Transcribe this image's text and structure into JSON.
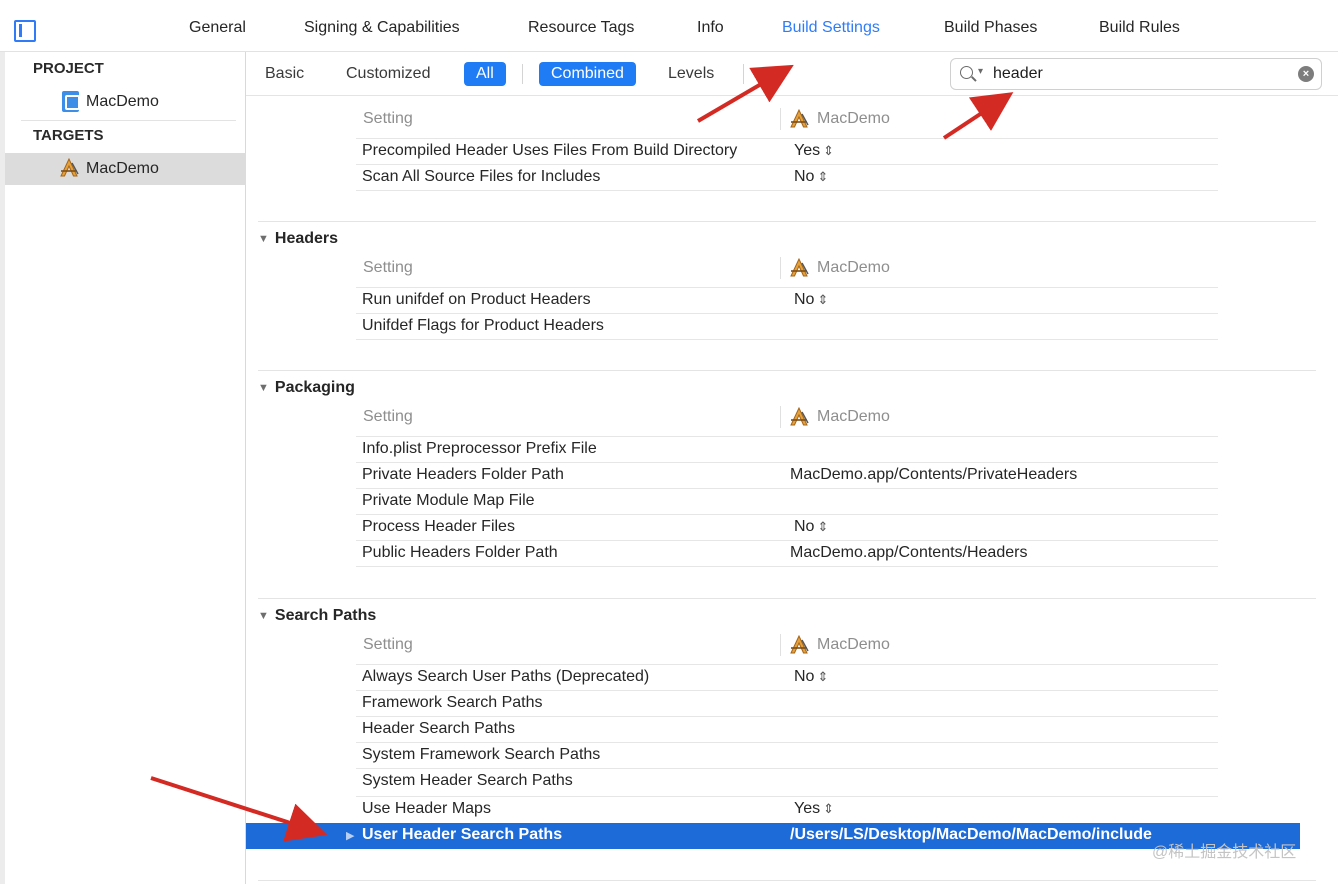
{
  "tabs": [
    {
      "label": "General",
      "active": false
    },
    {
      "label": "Signing & Capabilities",
      "active": false
    },
    {
      "label": "Resource Tags",
      "active": false
    },
    {
      "label": "Info",
      "active": false
    },
    {
      "label": "Build Settings",
      "active": true
    },
    {
      "label": "Build Phases",
      "active": false
    },
    {
      "label": "Build Rules",
      "active": false
    }
  ],
  "sidebar": {
    "project_header": "PROJECT",
    "project_item": "MacDemo",
    "targets_header": "TARGETS",
    "target_item": "MacDemo"
  },
  "filter": {
    "basic": "Basic",
    "customized": "Customized",
    "all": "All",
    "combined": "Combined",
    "levels": "Levels",
    "search_value": "header",
    "search_clear": "×"
  },
  "columns": {
    "setting": "Setting",
    "target": "MacDemo"
  },
  "groups": [
    {
      "title": "",
      "rows": [
        {
          "name": "Precompiled Header Uses Files From Build Directory",
          "value": "Yes",
          "popup": true
        },
        {
          "name": "Scan All Source Files for Includes",
          "value": "No",
          "popup": true
        }
      ]
    },
    {
      "title": "Headers",
      "rows": [
        {
          "name": "Run unifdef on Product Headers",
          "value": "No",
          "popup": true
        },
        {
          "name": "Unifdef Flags for Product Headers",
          "value": "",
          "popup": false
        }
      ]
    },
    {
      "title": "Packaging",
      "rows": [
        {
          "name": "Info.plist Preprocessor Prefix File",
          "value": "",
          "popup": false
        },
        {
          "name": "Private Headers Folder Path",
          "value": "MacDemo.app/Contents/PrivateHeaders",
          "popup": false
        },
        {
          "name": "Private Module Map File",
          "value": "",
          "popup": false
        },
        {
          "name": "Process Header Files",
          "value": "No",
          "popup": true
        },
        {
          "name": "Public Headers Folder Path",
          "value": "MacDemo.app/Contents/Headers",
          "popup": false
        }
      ]
    },
    {
      "title": "Search Paths",
      "rows": [
        {
          "name": "Always Search User Paths (Deprecated)",
          "value": "No",
          "popup": true
        },
        {
          "name": "Framework Search Paths",
          "value": "",
          "popup": false
        },
        {
          "name": "Header Search Paths",
          "value": "",
          "popup": false
        },
        {
          "name": "System Framework Search Paths",
          "value": "",
          "popup": false
        },
        {
          "name": "System Header Search Paths",
          "value": "",
          "popup": false
        },
        {
          "name": "Use Header Maps",
          "value": "Yes",
          "popup": true
        }
      ]
    }
  ],
  "selected_row": {
    "name": "User Header Search Paths",
    "value": "/Users/LS/Desktop/MacDemo/MacDemo/include"
  },
  "watermark": "@稀土掘金技术社区",
  "colors": {
    "accent": "#2f7cf6",
    "selection": "#1d6bd9",
    "annotation_arrow": "#d42a24"
  }
}
